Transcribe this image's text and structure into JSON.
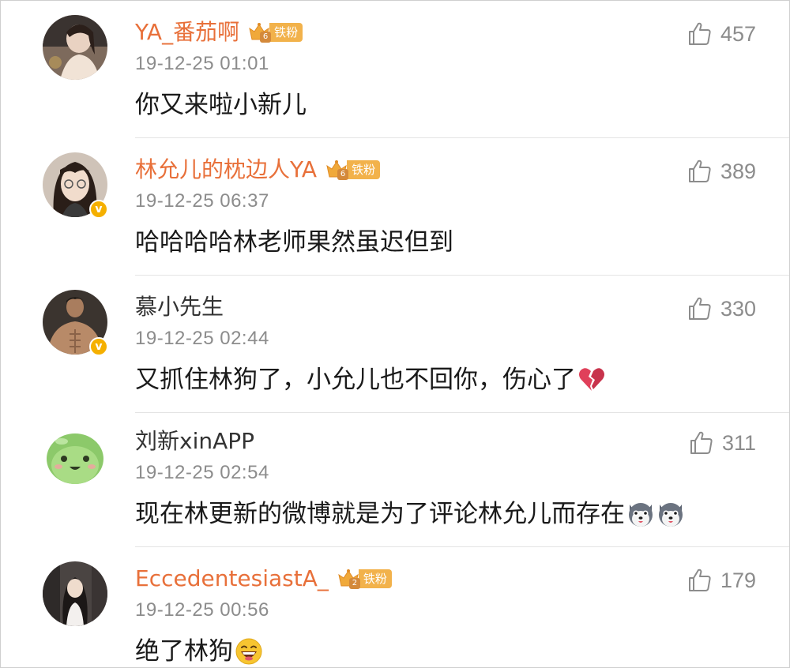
{
  "comments": [
    {
      "username": "YA_番茄啊",
      "has_fan_badge": true,
      "badge_level": "6",
      "badge_label": "铁粉",
      "verified": false,
      "timestamp": "19-12-25 01:01",
      "text": "你又来啦小新儿",
      "emojis": [],
      "likes": "457"
    },
    {
      "username": "林允儿的枕边人YA",
      "has_fan_badge": true,
      "badge_level": "6",
      "badge_label": "铁粉",
      "verified": true,
      "timestamp": "19-12-25 06:37",
      "text": "哈哈哈哈林老师果然虽迟但到",
      "emojis": [],
      "likes": "389"
    },
    {
      "username": "慕小先生",
      "has_fan_badge": false,
      "verified": true,
      "timestamp": "19-12-25 02:44",
      "text": "又抓住林狗了，小允儿也不回你，伤心了",
      "emojis": [
        "broken-heart"
      ],
      "likes": "330"
    },
    {
      "username": "刘新xinAPP",
      "has_fan_badge": false,
      "verified": false,
      "timestamp": "19-12-25 02:54",
      "text": "现在林更新的微博就是为了评论林允儿而存在",
      "emojis": [
        "husky",
        "husky"
      ],
      "likes": "311"
    },
    {
      "username": "EccedentesiastA_",
      "has_fan_badge": true,
      "badge_level": "2",
      "badge_label": "铁粉",
      "verified": false,
      "timestamp": "19-12-25 00:56",
      "text": "绝了林狗",
      "emojis": [
        "laughing-face"
      ],
      "likes": "179"
    }
  ],
  "colors": {
    "username_badged": "#e8703a",
    "username_plain": "#333333",
    "timestamp": "#8c8c8c",
    "badge_bg": "#f2b24b",
    "verified": "#f5b000"
  }
}
